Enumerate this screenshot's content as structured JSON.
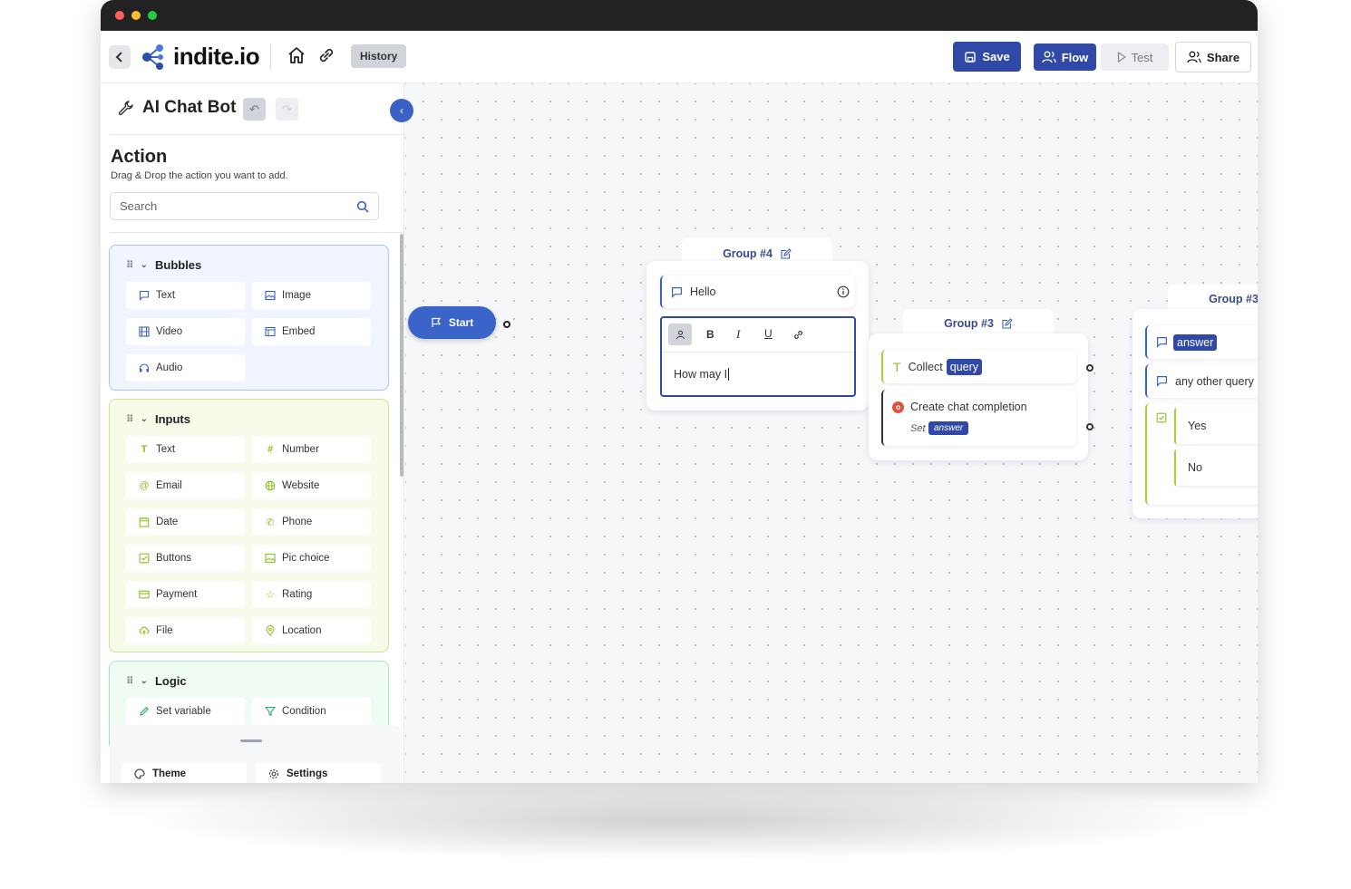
{
  "header": {
    "logo_text": "indite.io",
    "history_label": "History",
    "save_label": "Save",
    "flow_label": "Flow",
    "test_label": "Test",
    "share_label": "Share"
  },
  "sidebar": {
    "bot_title": "AI Chat Bot",
    "action_title": "Action",
    "action_subtitle": "Drag & Drop the action you want to add.",
    "search_placeholder": "Search",
    "sections": [
      {
        "title": "Bubbles",
        "items": [
          "Text",
          "Image",
          "Video",
          "Embed",
          "Audio"
        ]
      },
      {
        "title": "Inputs",
        "items": [
          "Text",
          "Number",
          "Email",
          "Website",
          "Date",
          "Phone",
          "Buttons",
          "Pic choice",
          "Payment",
          "Rating",
          "File",
          "Location"
        ]
      },
      {
        "title": "Logic",
        "items": [
          "Set variable",
          "Condition"
        ]
      }
    ],
    "theme_label": "Theme",
    "settings_label": "Settings"
  },
  "canvas": {
    "start_label": "Start",
    "group4": {
      "title": "Group #4",
      "hello_text": "Hello",
      "editor_text": "How may I"
    },
    "group3a": {
      "title": "Group #3",
      "collect_text": "Collect",
      "collect_var": "query",
      "completion_text": "Create chat completion",
      "set_label": "Set",
      "set_var": "answer"
    },
    "group3b": {
      "title": "Group #3",
      "answer_var": "answer",
      "other_text": "any other query",
      "yes_label": "Yes",
      "no_label": "No"
    }
  },
  "colors": {
    "primary": "#3049a7",
    "bubbles_bg": "#f0f5ff",
    "inputs_bg": "#f6fbea",
    "logic_bg": "#f0fbf4"
  }
}
